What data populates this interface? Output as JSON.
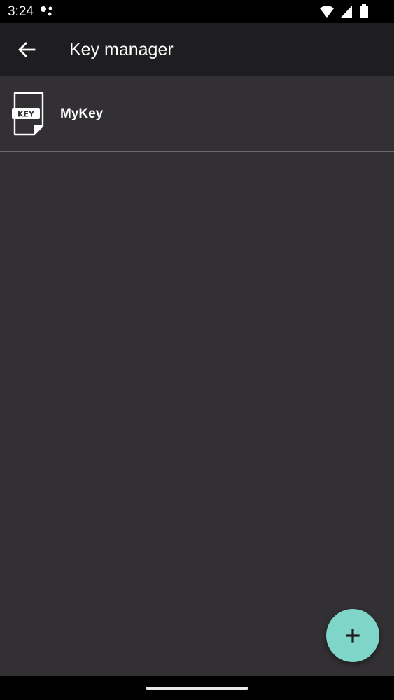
{
  "status_bar": {
    "time": "3:24",
    "icons": [
      "dual-dot-icon",
      "wifi-icon",
      "signal-icon",
      "battery-icon"
    ]
  },
  "app_bar": {
    "title": "Key manager",
    "back_icon": "arrow-left-icon"
  },
  "keys": {
    "items": [
      {
        "label": "MyKey",
        "icon": "key-file-icon",
        "icon_badge_text": "KEY"
      }
    ]
  },
  "fab": {
    "icon": "plus-icon"
  },
  "colors": {
    "background": "#323033",
    "app_bar": "#1e1d1f",
    "status_bar": "#000000",
    "divider": "#6b696c",
    "fab": "#7fd6c8",
    "text": "#ffffff"
  }
}
